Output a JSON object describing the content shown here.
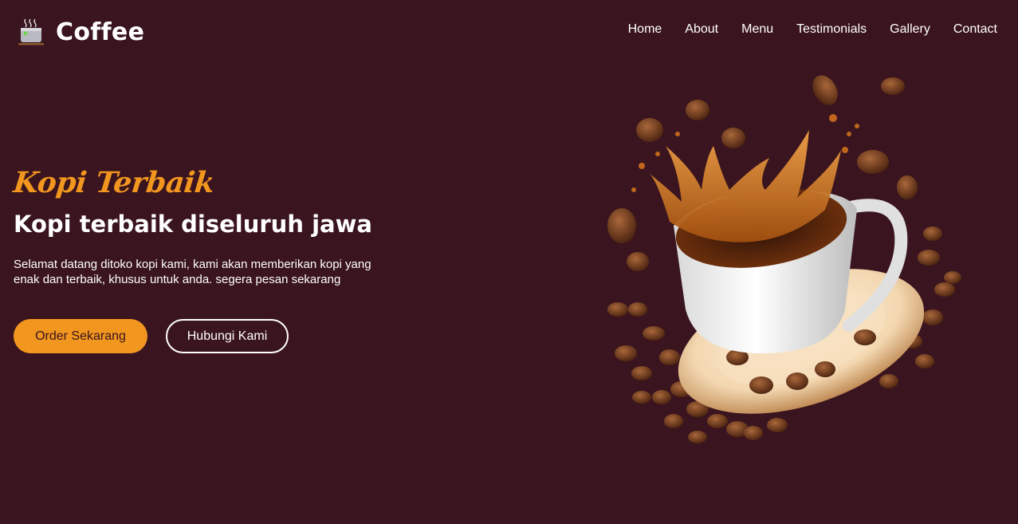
{
  "brand": {
    "name": "Coffee",
    "icon": "coffee-cup-icon"
  },
  "nav": {
    "items": [
      "Home",
      "About",
      "Menu",
      "Testimonials",
      "Gallery",
      "Contact"
    ]
  },
  "hero": {
    "tagline": "Kopi Terbaik",
    "headline": "Kopi terbaik diseluruh jawa",
    "description_line1": "Selamat datang ditoko kopi kami, kami akan memberikan kopi yang",
    "description_line2": "enak dan terbaik, khusus untuk anda. segera pesan sekarang",
    "primary_button": "Order Sekarang",
    "secondary_button": "Hubungi Kami",
    "image": "coffee-splash-image"
  },
  "colors": {
    "background": "#3a141e",
    "accent": "#f1961f",
    "text": "#ffffff"
  }
}
